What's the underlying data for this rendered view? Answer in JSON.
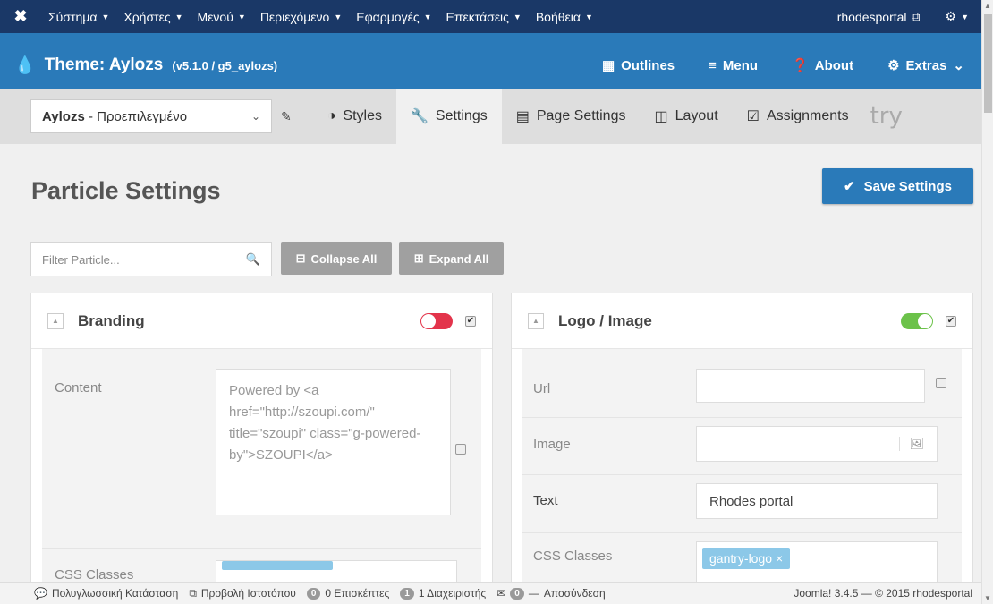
{
  "topbar": {
    "logo_icon": "joomla-icon",
    "menus": [
      "Σύστημα",
      "Χρήστες",
      "Μενού",
      "Περιεχόμενο",
      "Εφαρμογές",
      "Επεκτάσεις",
      "Βοήθεια"
    ],
    "site_name": "rhodesportal",
    "settings_icon": "gear-icon"
  },
  "gantry": {
    "title": "Theme: Aylozs",
    "version": "(v5.1.0 / g5_aylozs)",
    "nav": {
      "outlines": "Outlines",
      "menu": "Menu",
      "about": "About",
      "extras": "Extras"
    }
  },
  "tabs": {
    "outline_name": "Aylozs",
    "outline_sub": "Προεπιλεγμένο",
    "styles": "Styles",
    "settings": "Settings",
    "page_settings": "Page Settings",
    "layout": "Layout",
    "assignments": "Assignments",
    "try_logo": "try"
  },
  "main": {
    "title": "Particle Settings",
    "save_label": "Save Settings",
    "filter_placeholder": "Filter Particle...",
    "collapse_all": "Collapse All",
    "expand_all": "Expand All"
  },
  "branding": {
    "title": "Branding",
    "enabled": false,
    "content_label": "Content",
    "content_value": "Powered by <a href=\"http://szoupi.com/\" title=\"szoupi\" class=\"g-powered-by\">SZOUPI</a>",
    "css_label": "CSS Classes"
  },
  "logo": {
    "title": "Logo / Image",
    "enabled": true,
    "url_label": "Url",
    "image_label": "Image",
    "text_label": "Text",
    "text_value": "Rhodes portal",
    "css_label": "CSS Classes",
    "css_tag": "gantry-logo"
  },
  "status": {
    "multilang": "Πολυγλωσσική Κατάσταση",
    "view_site": "Προβολή Ιστοτόπου",
    "visitors_count": "0",
    "visitors": "0 Επισκέπτες",
    "admins_count": "1",
    "admins": "1 Διαχειριστής",
    "messages_count": "0",
    "logout": "Αποσύνδεση",
    "version": "Joomla! 3.4.5 — © 2015 rhodesportal"
  }
}
